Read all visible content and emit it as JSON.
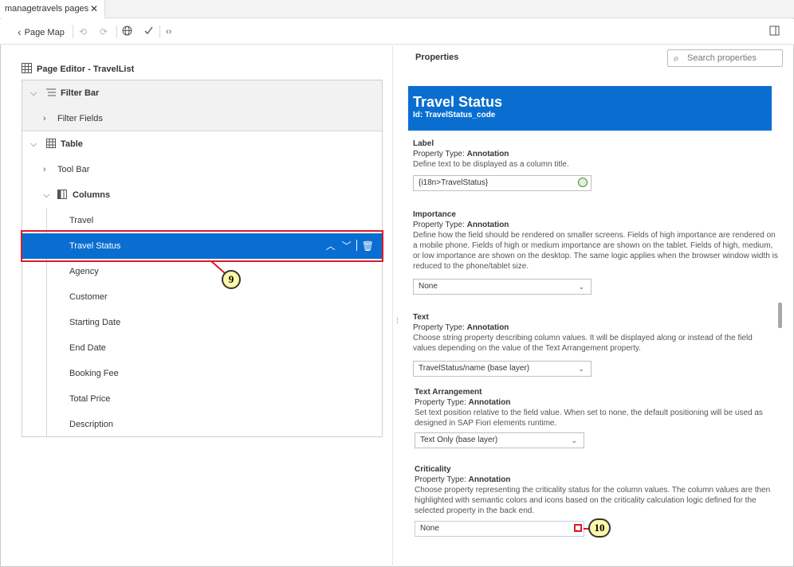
{
  "tab": {
    "title": "managetravels pages",
    "close": "✕"
  },
  "toolbar": {
    "page_map": "Page Map",
    "back_icon": "‹",
    "undo_icon": "⟲",
    "redo_icon": "⟳",
    "globe_icon": "🌐",
    "check_icon": "✓",
    "code_icon": "‹›",
    "panel_icon": "▯"
  },
  "left": {
    "title": "Page Editor - TravelList",
    "tree": {
      "filter_bar": "Filter Bar",
      "filter_fields": "Filter Fields",
      "table": "Table",
      "tool_bar": "Tool Bar",
      "columns": "Columns",
      "column_items": [
        "Travel",
        "Travel Status",
        "Agency",
        "Customer",
        "Starting Date",
        "End Date",
        "Booking Fee",
        "Total Price",
        "Description"
      ]
    },
    "callout_9": "9"
  },
  "right": {
    "title": "Properties",
    "search_placeholder": "Search properties",
    "header": {
      "title": "Travel Status",
      "id": "Id: TravelStatus_code"
    },
    "label_section": {
      "name": "Label",
      "type_prefix": "Property Type:",
      "type_value": "Annotation",
      "desc": "Define text to be displayed as a column title.",
      "value": "{i18n>TravelStatus}"
    },
    "importance_section": {
      "name": "Importance",
      "type_prefix": "Property Type:",
      "type_value": "Annotation",
      "desc": "Define how the field should be rendered on smaller screens. Fields of high importance are rendered on a mobile phone. Fields of high or medium importance are shown on the tablet. Fields of high, medium, or low importance are shown on the desktop. The same logic applies when the browser window width is reduced to the phone/tablet size.",
      "value": "None"
    },
    "text_section": {
      "name": "Text",
      "type_prefix": "Property Type:",
      "type_value": "Annotation",
      "desc": "Choose string property describing column values. It will be displayed along or instead of the field values depending on the value of the Text Arrangement property.",
      "value": "TravelStatus/name (base layer)"
    },
    "arrangement_section": {
      "name": "Text Arrangement",
      "type_prefix": "Property Type:",
      "type_value": "Annotation",
      "desc": "Set text position relative to the field value. When set to none, the default positioning will be used as designed in SAP Fiori elements runtime.",
      "value": "Text Only (base layer)"
    },
    "criticality_section": {
      "name": "Criticality",
      "type_prefix": "Property Type:",
      "type_value": "Annotation",
      "desc": "Choose property representing the criticality status for the column values. The column values are then highlighted with semantic colors and icons based on the criticality calculation logic defined for the selected property in the back end.",
      "value": "None"
    },
    "callout_10": "10"
  }
}
